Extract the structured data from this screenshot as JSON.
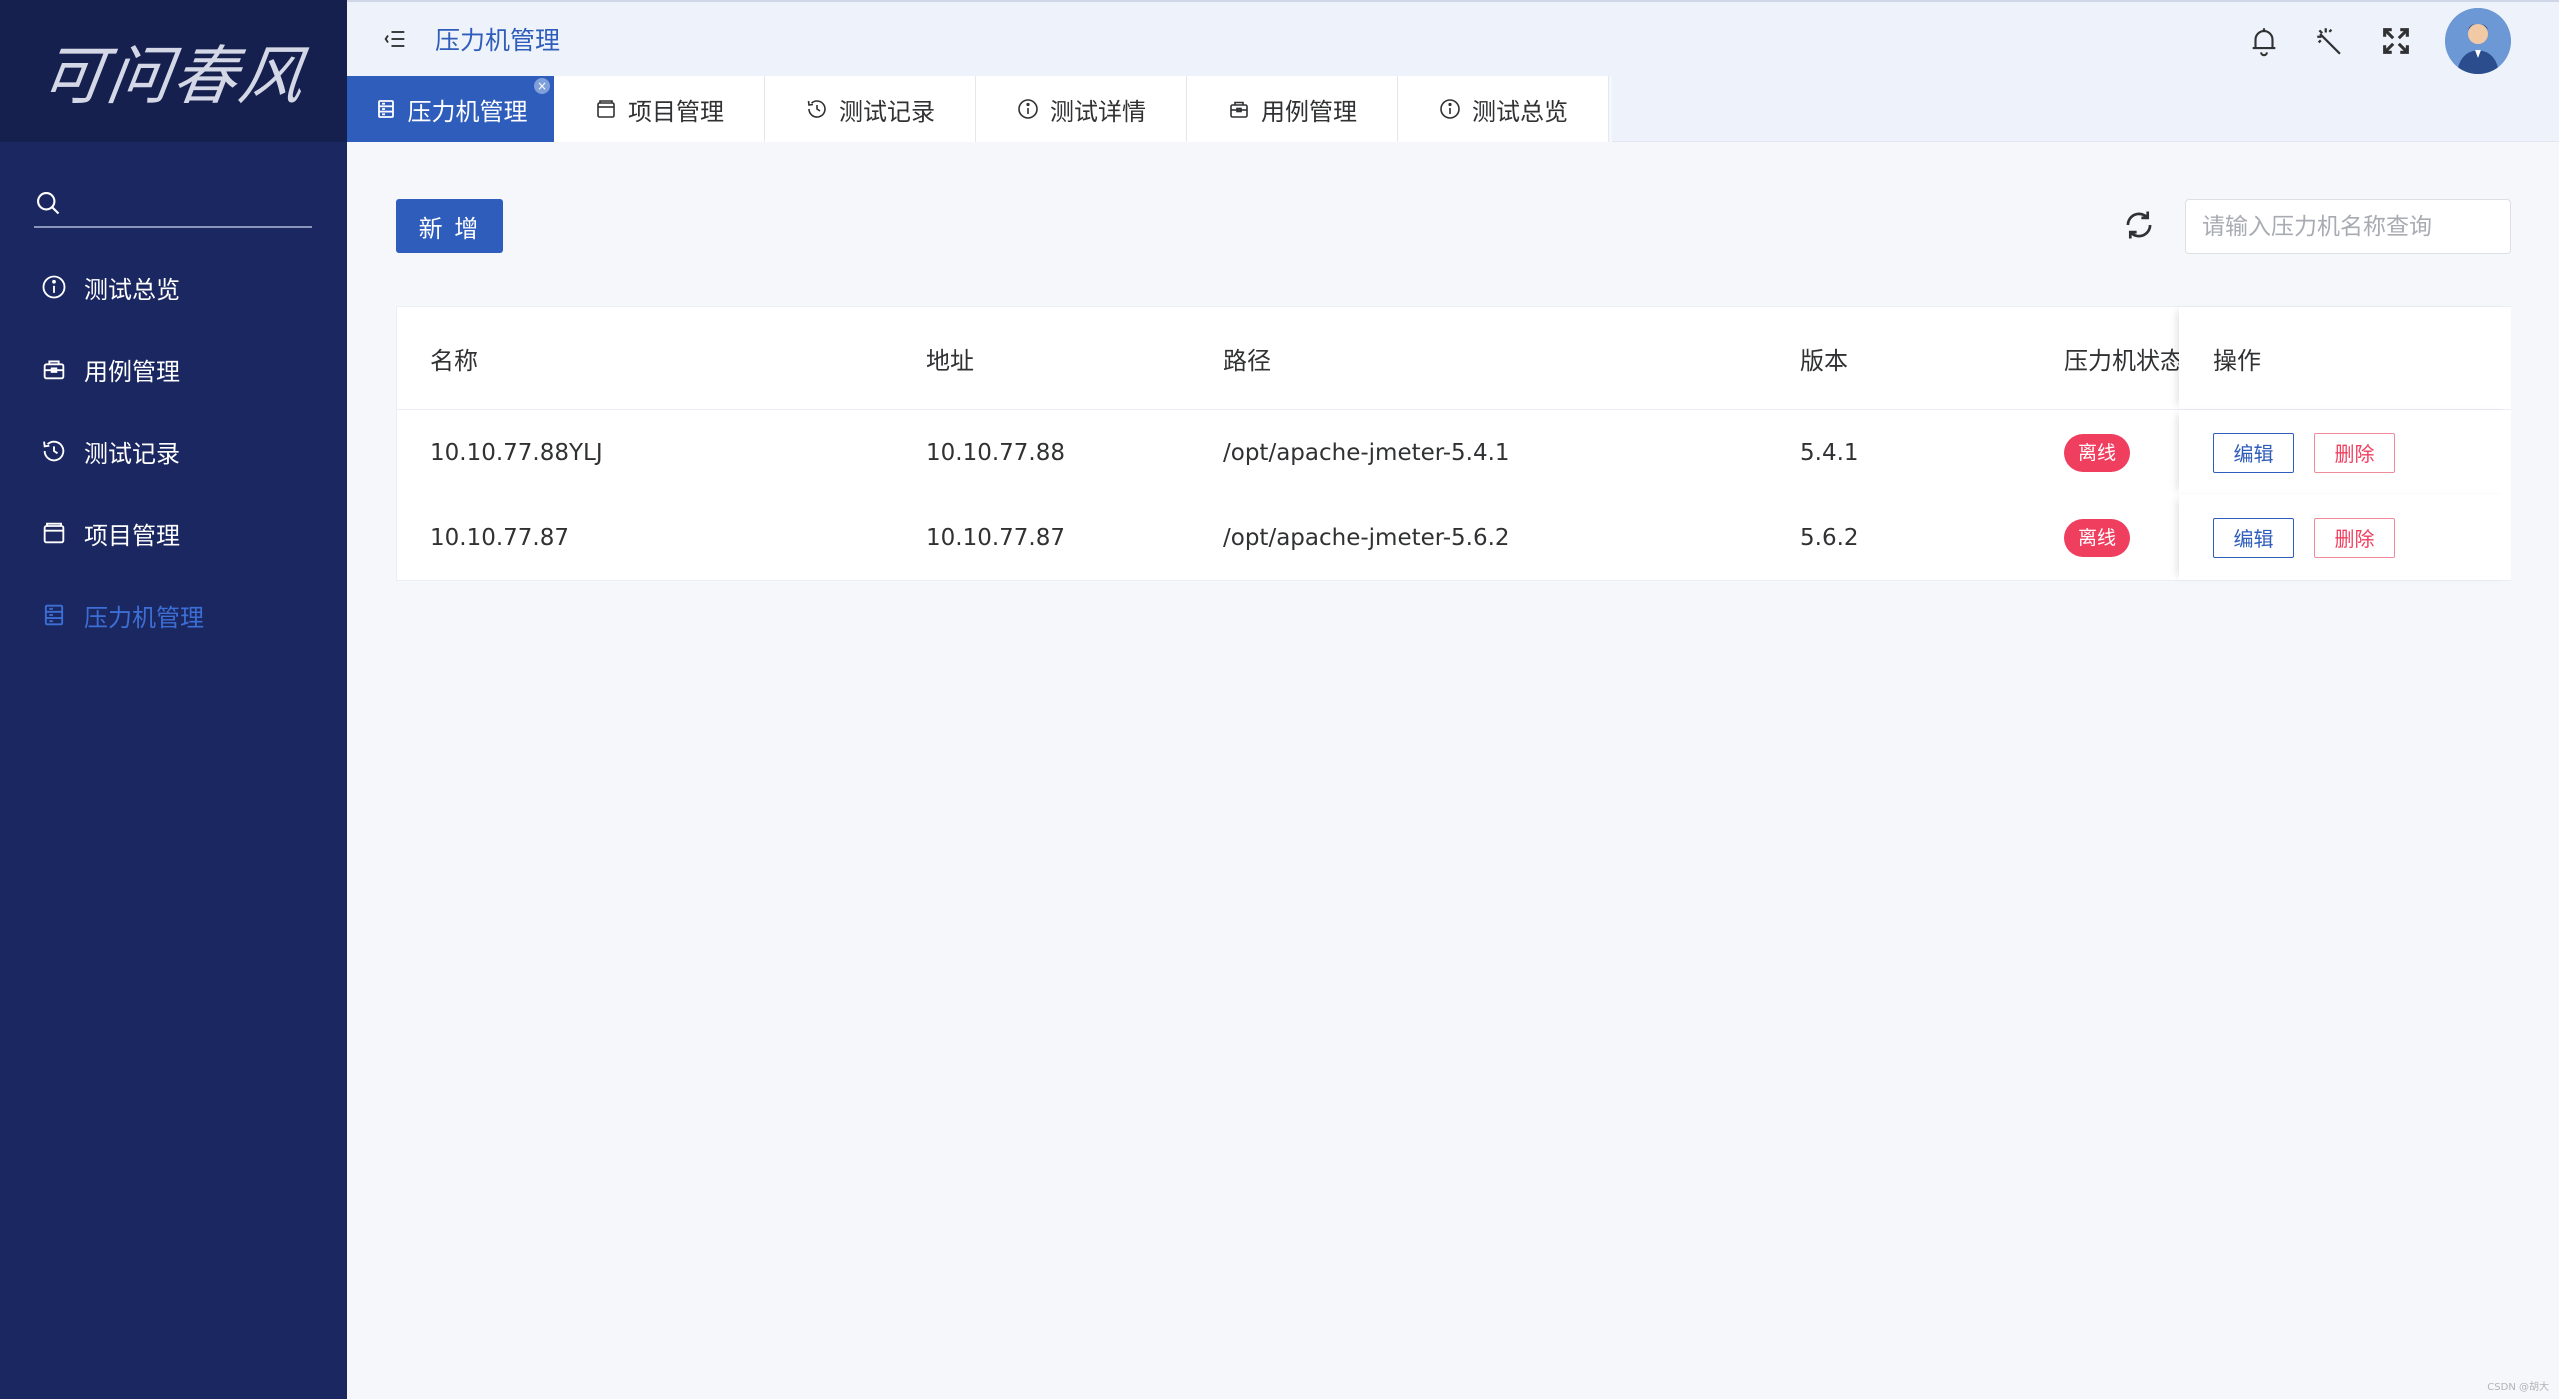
{
  "sidebar": {
    "logo_text": "可问春风",
    "search_icon": "search-icon",
    "items": [
      {
        "label": "测试总览",
        "icon": "info-icon",
        "active": false
      },
      {
        "label": "用例管理",
        "icon": "case-icon",
        "active": false
      },
      {
        "label": "测试记录",
        "icon": "history-icon",
        "active": false
      },
      {
        "label": "项目管理",
        "icon": "project-icon",
        "active": false
      },
      {
        "label": "压力机管理",
        "icon": "server-icon",
        "active": true
      }
    ]
  },
  "header": {
    "breadcrumb_current": "压力机管理",
    "icons": [
      "bell-icon",
      "magic-wand-icon",
      "fullscreen-icon"
    ],
    "avatar": "avatar"
  },
  "tabs": [
    {
      "label": "压力机管理",
      "icon": "server-icon",
      "active": true,
      "closable": true
    },
    {
      "label": "项目管理",
      "icon": "project-icon",
      "active": false
    },
    {
      "label": "测试记录",
      "icon": "history-icon",
      "active": false
    },
    {
      "label": "测试详情",
      "icon": "info-icon",
      "active": false
    },
    {
      "label": "用例管理",
      "icon": "case-icon",
      "active": false
    },
    {
      "label": "测试总览",
      "icon": "info-icon",
      "active": false
    }
  ],
  "toolbar": {
    "add_label": "新 增",
    "search_placeholder": "请输入压力机名称查询"
  },
  "table": {
    "columns": [
      "名称",
      "地址",
      "路径",
      "版本",
      "压力机状态",
      "操作"
    ],
    "rows": [
      {
        "name": "10.10.77.88YLJ",
        "address": "10.10.77.88",
        "path": "/opt/apache-jmeter-5.4.1",
        "version": "5.4.1",
        "status": "离线",
        "edit": "编辑",
        "delete": "删除"
      },
      {
        "name": "10.10.77.87",
        "address": "10.10.77.87",
        "path": "/opt/apache-jmeter-5.6.2",
        "version": "5.6.2",
        "status": "离线",
        "edit": "编辑",
        "delete": "删除"
      }
    ]
  },
  "watermark": "CSDN @胡大",
  "colors": {
    "sidebar_bg": "#1b2760",
    "primary": "#2f5dbb",
    "offline_badge": "#f03e5f",
    "delete_text": "#f03e5f"
  }
}
